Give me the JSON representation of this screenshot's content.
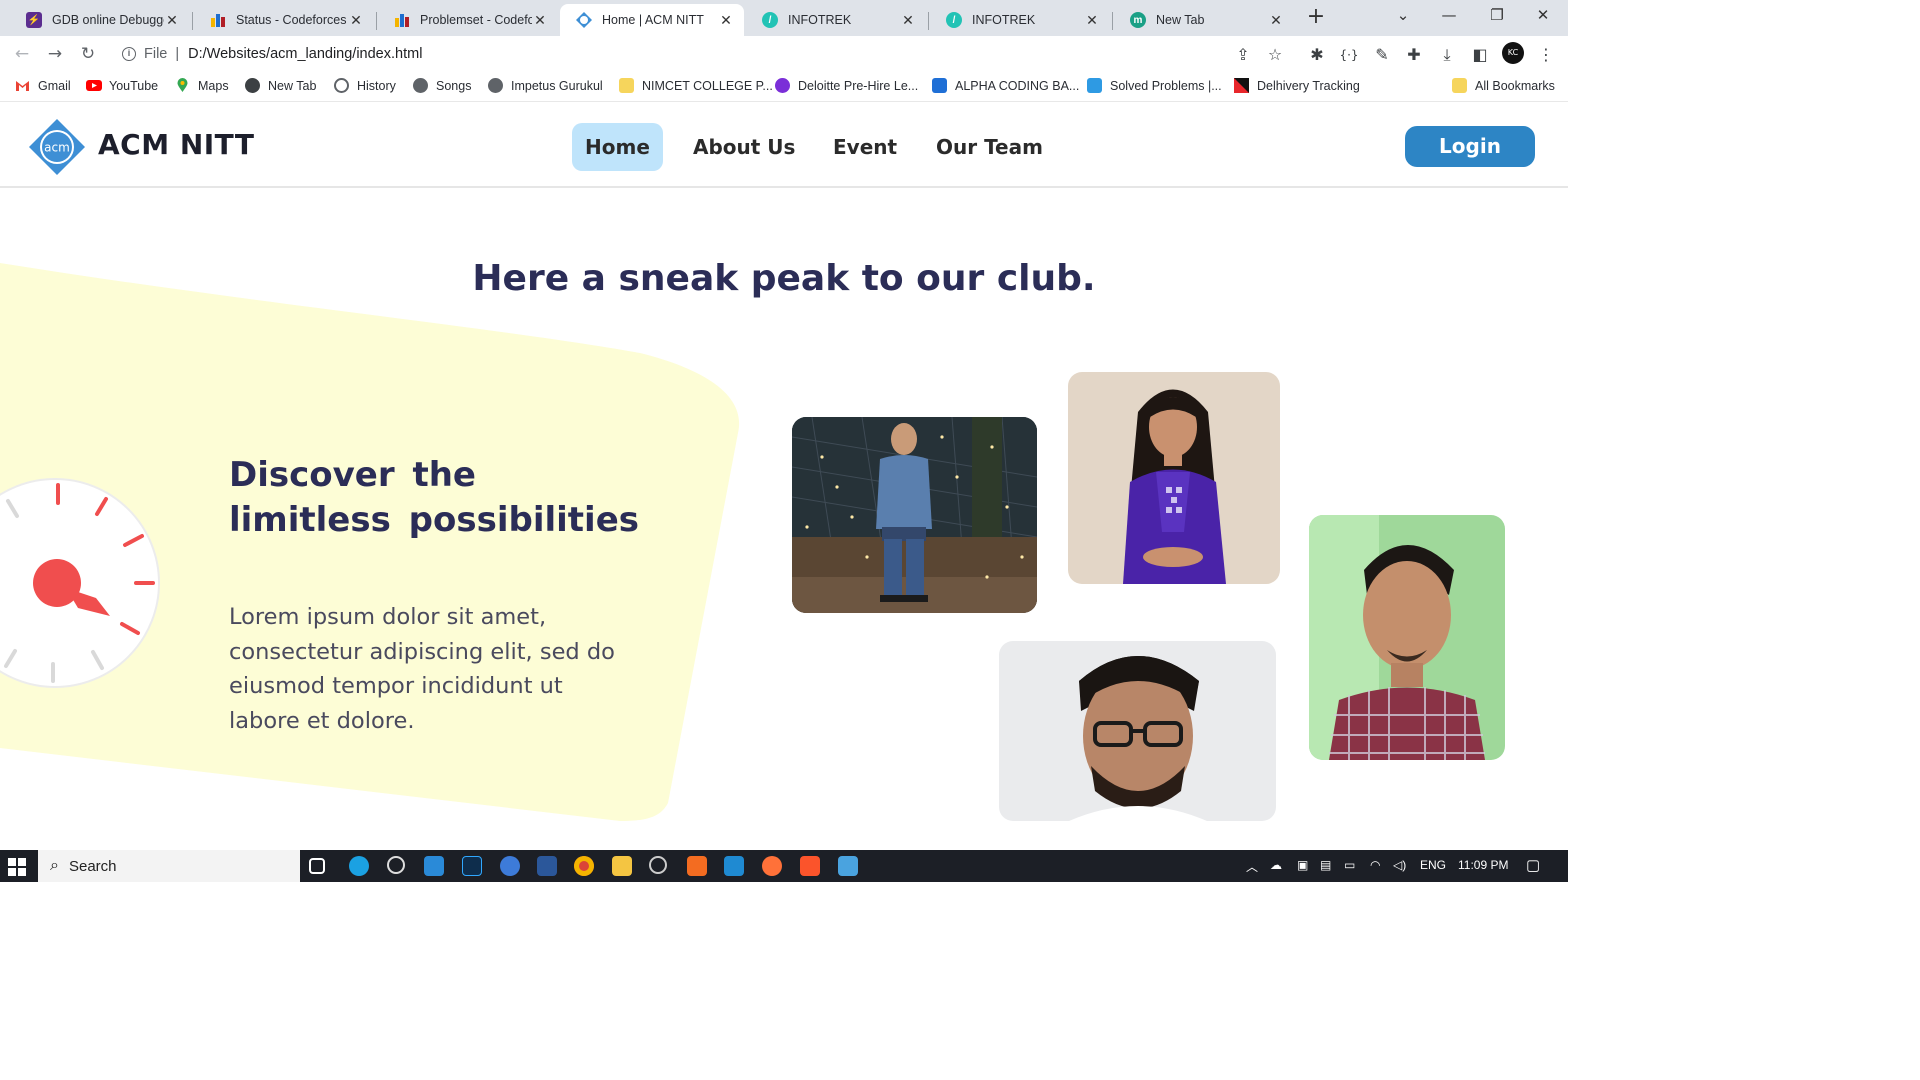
{
  "browser": {
    "tabs": [
      {
        "title": "GDB online Debugger",
        "favicon": "gdb-icon",
        "color": "#6b3fa0"
      },
      {
        "title": "Status - Codeforces",
        "favicon": "codeforces-icon",
        "color": "#f4b400"
      },
      {
        "title": "Problemset - Codeforces",
        "favicon": "codeforces-icon",
        "color": "#f4b400"
      },
      {
        "title": "Home | ACM NITT",
        "favicon": "acm-icon",
        "color": "#3e8fd5",
        "active": true
      },
      {
        "title": "INFOTREK",
        "favicon": "infotrek-icon",
        "color": "#22c3b5"
      },
      {
        "title": "INFOTREK",
        "favicon": "infotrek-icon",
        "color": "#22c3b5"
      },
      {
        "title": "New Tab",
        "favicon": "new-tab-icon",
        "color": "#1aa086"
      }
    ],
    "url_scheme": "File",
    "url": "D:/Websites/acm_landing/index.html",
    "bookmarks": [
      {
        "label": "Gmail",
        "icon": "gmail-icon",
        "color": "#ea4335"
      },
      {
        "label": "YouTube",
        "icon": "youtube-icon",
        "color": "#ff0000"
      },
      {
        "label": "Maps",
        "icon": "maps-icon",
        "color": "#34a853"
      },
      {
        "label": "New Tab",
        "icon": "new-tab-icon",
        "color": "#3c4043"
      },
      {
        "label": "History",
        "icon": "history-icon",
        "color": "#5f6368"
      },
      {
        "label": "Songs",
        "icon": "globe-icon",
        "color": "#5f6368"
      },
      {
        "label": "Impetus Gurukul",
        "icon": "globe-icon",
        "color": "#5f6368"
      },
      {
        "label": "NIMCET COLLEGE P...",
        "icon": "folder-icon",
        "color": "#f6d55c"
      },
      {
        "label": "Deloitte Pre-Hire Le...",
        "icon": "deloitte-icon",
        "color": "#7b2fd8"
      },
      {
        "label": "ALPHA CODING BA...",
        "icon": "alpha-icon",
        "color": "#1f6fd6"
      },
      {
        "label": "Solved Problems |...",
        "icon": "dsa-icon",
        "color": "#2e9ae3"
      },
      {
        "label": "Delhivery Tracking",
        "icon": "delhivery-icon",
        "color": "#e8262b"
      },
      {
        "label": "All Bookmarks",
        "icon": "folder-icon",
        "color": "#f6d55c"
      }
    ]
  },
  "site": {
    "brand": "ACM NITT",
    "logo_text": "acm",
    "nav": [
      "Home",
      "About Us",
      "Event",
      "Our Team"
    ],
    "login": "Login",
    "heading": "Here a sneak peak to our club.",
    "discover_title": "Discover the limitless possibilities",
    "discover_body": "Lorem ipsum dolor sit amet, consectetur adipiscing elit, sed do eiusmod tempor incididunt ut labore et dolore.",
    "colors": {
      "accent": "#2d85c5",
      "nav_active_bg": "#bfe4fb",
      "heading": "#2b2d57",
      "blob": "#fdfdd6",
      "clock_red": "#f04e4e"
    }
  },
  "taskbar": {
    "search_label": "Search",
    "tray_lang": "ENG",
    "tray_time": "11:09 PM"
  }
}
